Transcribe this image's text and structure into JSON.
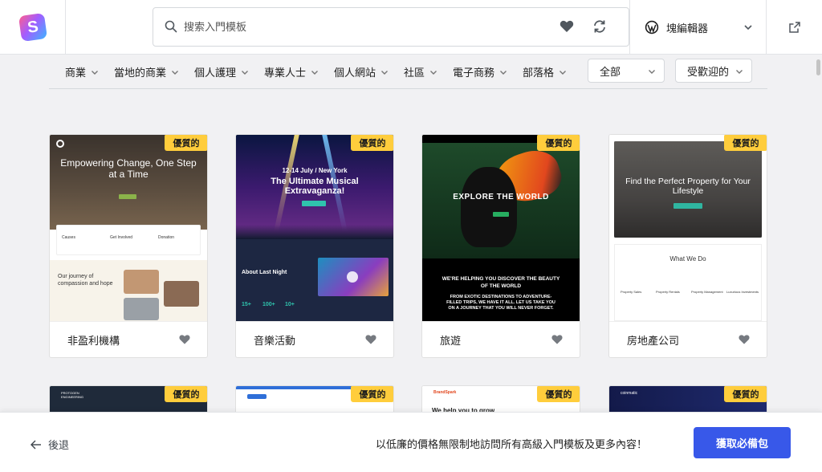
{
  "search": {
    "placeholder": "搜索入門模板"
  },
  "editor": {
    "label": "塊編輯器"
  },
  "categories": [
    "商業",
    "當地的商業",
    "個人護理",
    "專業人士",
    "個人網站",
    "社區",
    "電子商務",
    "部落格"
  ],
  "filters": {
    "type_value": "全部",
    "sort_value": "受歡迎的"
  },
  "badge_label": "優質的",
  "cards": [
    {
      "title": "非盈利機構",
      "headline": "Empowering Change, One Step at a Time",
      "sub": "Our journey of compassion and hope",
      "steps": [
        "Causes",
        "Get Involved",
        "Donation"
      ]
    },
    {
      "title": "音樂活動",
      "eyebrow": "12-14 July / New York",
      "headline": "The Ultimate Musical Extravaganza!",
      "sub": "About Last Night",
      "stats": [
        "15+",
        "100+",
        "10+"
      ]
    },
    {
      "title": "旅遊",
      "headline": "EXPLORE THE WORLD",
      "sub": "WE'RE HELPING YOU DISCOVER THE BEAUTY OF THE WORLD",
      "sub2": "FROM EXOTIC DESTINATIONS TO ADVENTURE-FILLED TRIPS, WE HAVE IT ALL. LET US TAKE YOU ON A JOURNEY THAT YOU WILL NEVER FORGET."
    },
    {
      "title": "房地產公司",
      "headline": "Find the Perfect Property for Your Lifestyle",
      "sub": "What We Do",
      "cols": [
        "Property Sales",
        "Property Rentals",
        "Property Management",
        "Luxurious Investments"
      ]
    }
  ],
  "row2": [
    {
      "logo": "PROTOGEN ENGINEERING"
    },
    {
      "logo": ""
    },
    {
      "logo": "BrandSpark",
      "headline": "We help you to grow"
    },
    {
      "logo": "coinmatic"
    }
  ],
  "bottom": {
    "back_label": "後退",
    "promo": "以低廉的價格無限制地訪問所有高級入門模板及更多內容！",
    "cta": "獲取必備包"
  },
  "colors": {
    "accent": "#3858e9",
    "badge": "#ffcd3c"
  }
}
